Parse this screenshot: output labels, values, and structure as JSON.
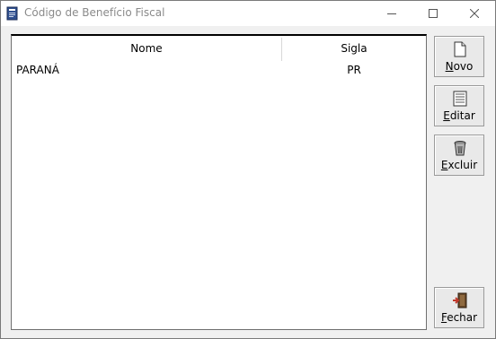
{
  "window": {
    "title": "Código de Benefício Fiscal"
  },
  "grid": {
    "columns": [
      "Nome",
      "Sigla"
    ],
    "rows": [
      {
        "nome": "PARANÁ",
        "sigla": "PR"
      }
    ]
  },
  "buttons": {
    "novo": {
      "mnemonic": "N",
      "rest": "ovo"
    },
    "editar": {
      "mnemonic": "E",
      "rest": "ditar"
    },
    "excluir": {
      "mnemonic": "E",
      "rest": "xcluir"
    },
    "fechar": {
      "mnemonic": "F",
      "rest": "echar"
    }
  },
  "icons": {
    "app": "document-app-icon",
    "novo": "new-document-icon",
    "editar": "edit-document-icon",
    "excluir": "trash-icon",
    "fechar": "exit-door-icon"
  }
}
